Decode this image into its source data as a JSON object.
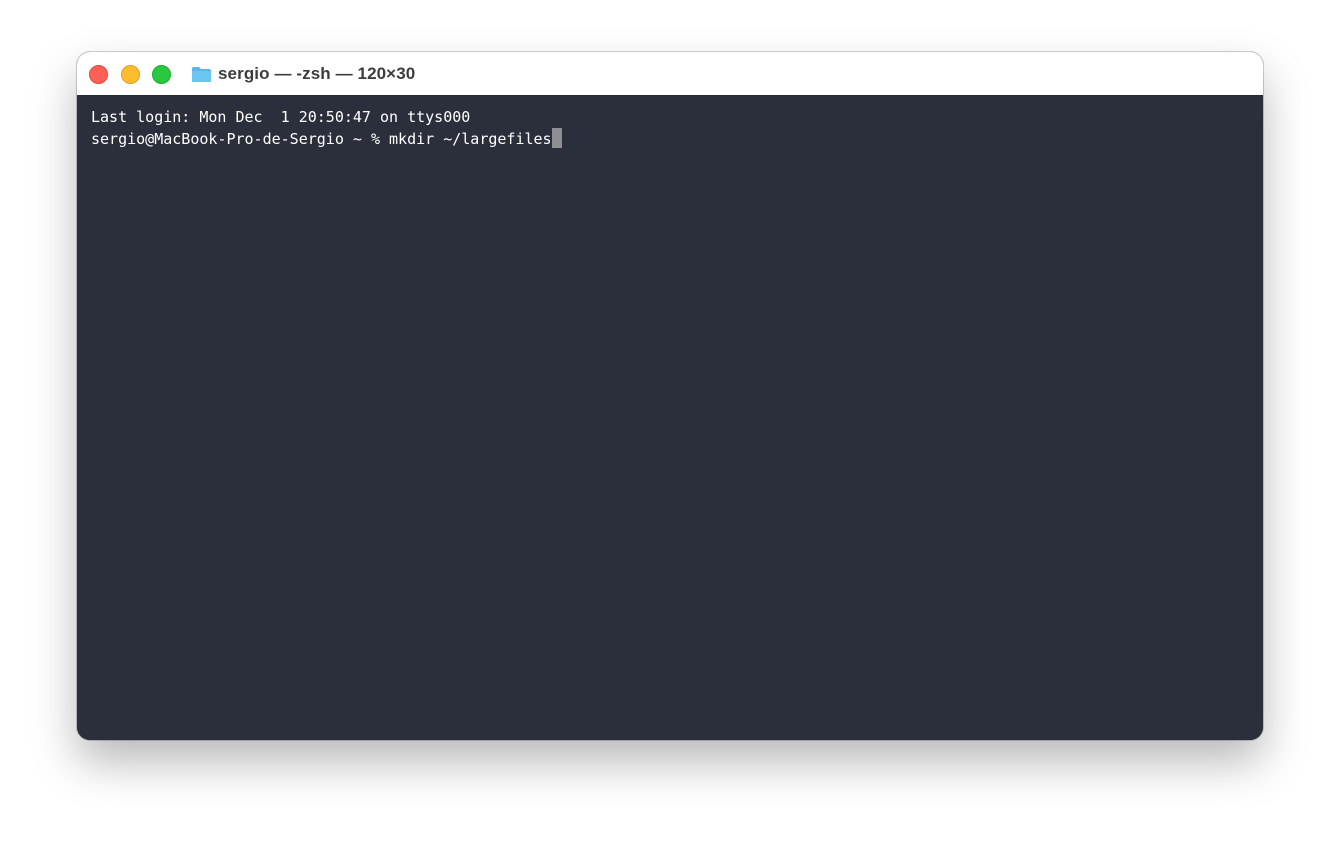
{
  "window": {
    "title": "sergio — -zsh — 120×30"
  },
  "titlebar": {
    "buttons": {
      "close_color": "#fe5f57",
      "minimize_color": "#febc2e",
      "zoom_color": "#28c840"
    },
    "icon": "folder-icon"
  },
  "terminal": {
    "lines": [
      "Last login: Mon Dec  1 20:50:47 on ttys000"
    ],
    "prompt": "sergio@MacBook-Pro-de-Sergio ~ % ",
    "command": "mkdir ~/largefiles",
    "background_color": "#2b2f3b",
    "text_color": "#ffffff"
  }
}
